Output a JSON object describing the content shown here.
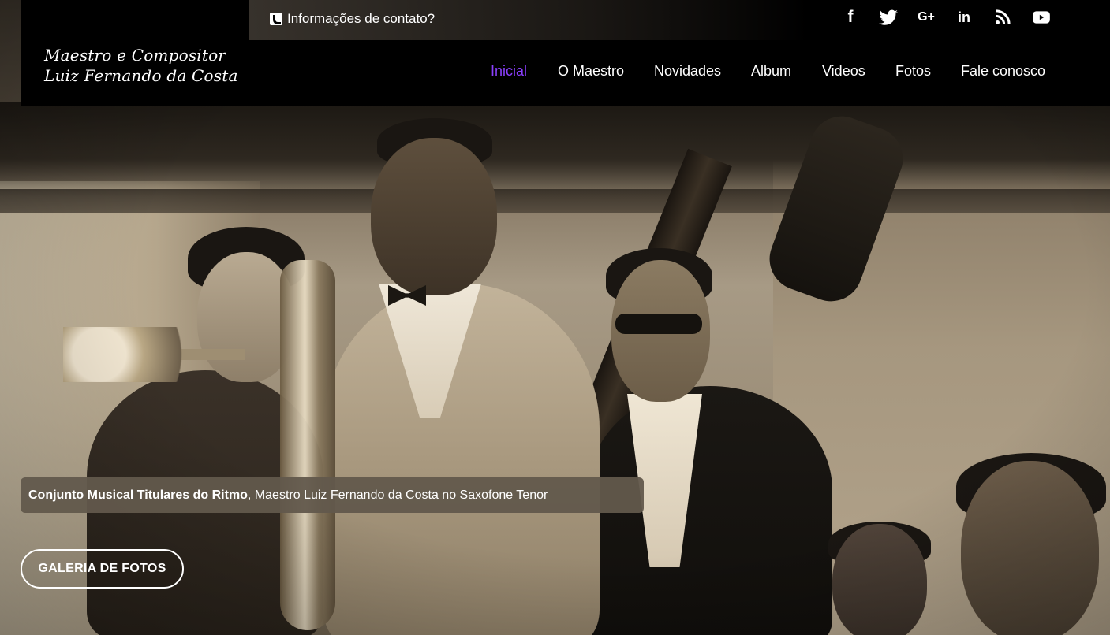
{
  "brand": {
    "line1": "Maestro e Compositor",
    "line2": "Luiz Fernando da Costa"
  },
  "contact": {
    "label": "Informações de contato?",
    "icon": "phone-square-icon"
  },
  "social": [
    {
      "name": "facebook-icon",
      "glyph": "f"
    },
    {
      "name": "twitter-icon",
      "glyph": "🐦"
    },
    {
      "name": "google-plus-icon",
      "glyph": "G+"
    },
    {
      "name": "linkedin-icon",
      "glyph": "in"
    },
    {
      "name": "rss-icon",
      "glyph": "◝"
    },
    {
      "name": "youtube-icon",
      "glyph": "▶"
    }
  ],
  "nav": {
    "items": [
      {
        "label": "Inicial",
        "active": true
      },
      {
        "label": "O Maestro",
        "active": false
      },
      {
        "label": "Novidades",
        "active": false
      },
      {
        "label": "Album",
        "active": false
      },
      {
        "label": "Videos",
        "active": false
      },
      {
        "label": "Fotos",
        "active": false
      },
      {
        "label": "Fale conosco",
        "active": false
      }
    ],
    "active_color": "#8a3ffc"
  },
  "hero": {
    "caption_bold": "Conjunto Musical Titulares do Ritmo",
    "caption_rest": ", Maestro Luiz Fernando da Costa no Saxofone Tenor",
    "button_label": "GALERIA DE FOTOS"
  }
}
